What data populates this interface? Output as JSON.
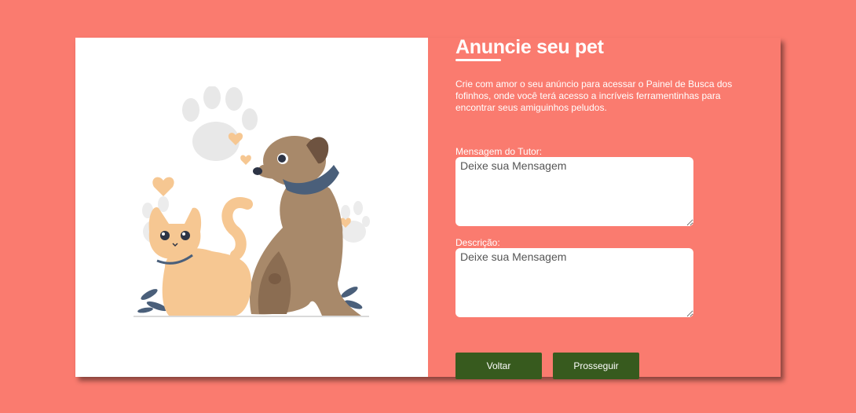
{
  "header": {
    "title": "Anuncie seu pet"
  },
  "intro": {
    "text": "Crie com amor o seu anúncio para acessar o Painel de Busca dos fofinhos, onde você terá acesso a incríveis ferramentinhas para encontrar seus amiguinhos peludos."
  },
  "form": {
    "tutor_message": {
      "label": "Mensagem do Tutor:",
      "placeholder": "Deixe sua Mensagem",
      "value": ""
    },
    "description": {
      "label": "Descrição:",
      "placeholder": "Deixe sua Mensagem",
      "value": ""
    }
  },
  "actions": {
    "back_label": "Voltar",
    "next_label": "Prosseguir"
  },
  "illustration": {
    "icon": "dog-and-cat-illustration"
  },
  "colors": {
    "background": "#fa7b6f",
    "panel_left": "#ffffff",
    "button": "#375a1e",
    "text_light": "#ffffff"
  }
}
